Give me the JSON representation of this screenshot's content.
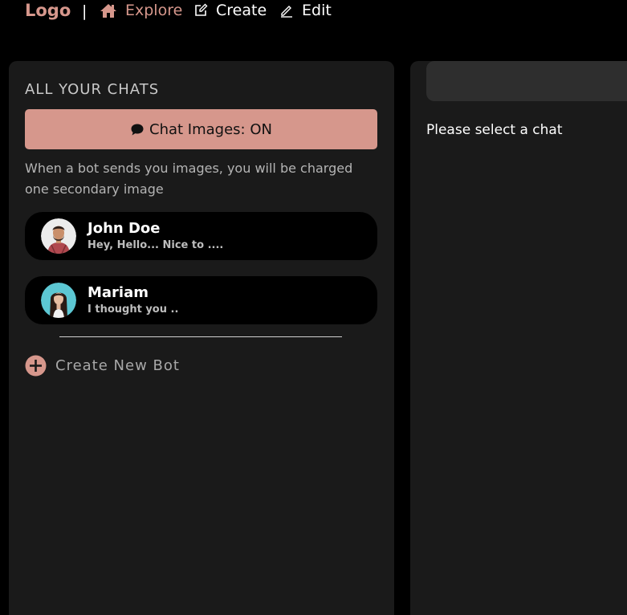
{
  "nav": {
    "logo": "Logo",
    "separator": "|",
    "items": [
      {
        "label": "Explore",
        "icon": "home-icon",
        "active": true
      },
      {
        "label": "Create",
        "icon": "edit-square-icon",
        "active": false
      },
      {
        "label": "Edit",
        "icon": "pencil-icon",
        "active": false
      }
    ]
  },
  "sidebar": {
    "title": "ALL YOUR CHATS",
    "toggle_label": "Chat Images: ON",
    "toggle_icon": "chat-bubble-icon",
    "toggle_note": "When a bot sends you images, you will be charged one secondary image",
    "chats": [
      {
        "name": "John Doe",
        "preview": "Hey, Hello... Nice to ...."
      },
      {
        "name": "Mariam",
        "preview": "I thought you .."
      }
    ],
    "create_label": "Create New Bot",
    "create_icon": "plus-circle-icon"
  },
  "main": {
    "empty_text": "Please select a chat"
  },
  "colors": {
    "accent": "#d6978c",
    "background": "#000000",
    "panel": "#1a1a1a",
    "header_bar": "#2e2e2e"
  }
}
